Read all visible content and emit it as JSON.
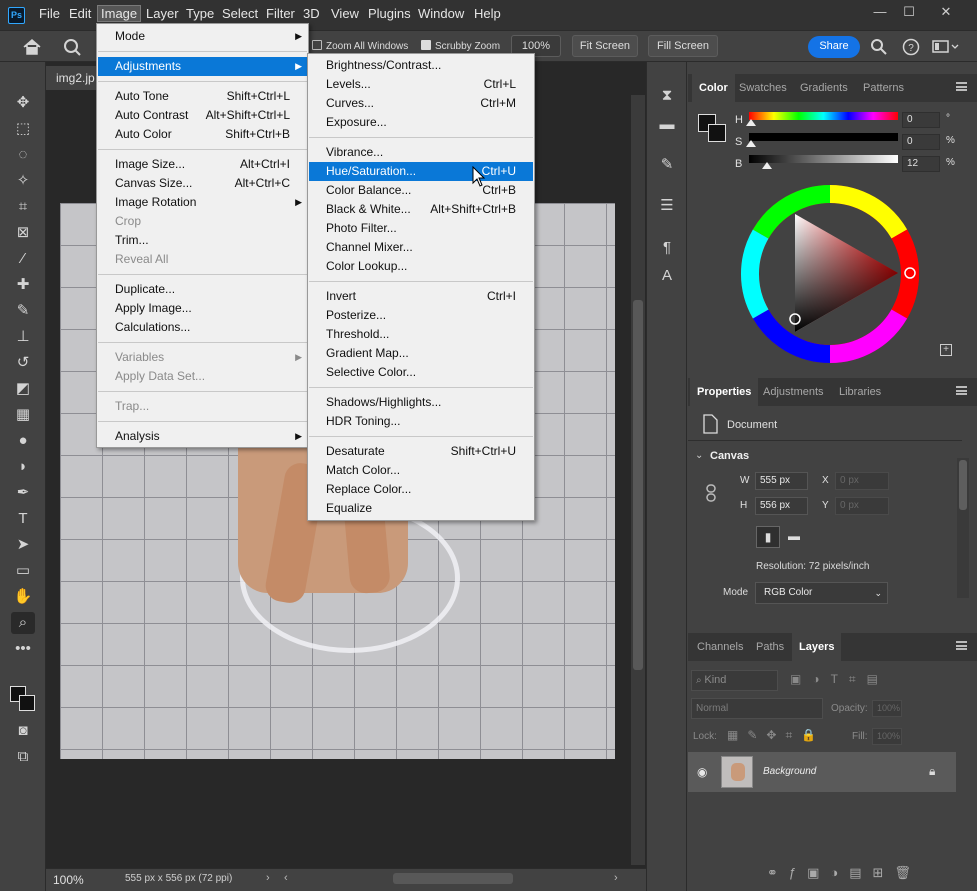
{
  "menubar": {
    "logo": "Ps",
    "items": [
      "File",
      "Edit",
      "Image",
      "Layer",
      "Type",
      "Select",
      "Filter",
      "3D",
      "View",
      "Plugins",
      "Window",
      "Help"
    ],
    "active": "Image",
    "window_controls": {
      "minimize": "—",
      "maximize": "☐",
      "close": "✕"
    }
  },
  "options_bar": {
    "zoom_all_windows": "Zoom All Windows",
    "scrubby_zoom": "Scrubby Zoom",
    "zoom_value": "100%",
    "fit_screen": "Fit Screen",
    "fill_screen": "Fill Screen",
    "share": "Share"
  },
  "document": {
    "tab_name": "img2.jp",
    "zoom": "100%",
    "status": "555 px x 556 px (72 ppi)"
  },
  "image_menu": {
    "groups": [
      [
        {
          "label": "Mode",
          "submenu": true
        }
      ],
      [
        {
          "label": "Adjustments",
          "submenu": true,
          "highlight": true
        }
      ],
      [
        {
          "label": "Auto Tone",
          "shortcut": "Shift+Ctrl+L"
        },
        {
          "label": "Auto Contrast",
          "shortcut": "Alt+Shift+Ctrl+L"
        },
        {
          "label": "Auto Color",
          "shortcut": "Shift+Ctrl+B"
        }
      ],
      [
        {
          "label": "Image Size...",
          "shortcut": "Alt+Ctrl+I"
        },
        {
          "label": "Canvas Size...",
          "shortcut": "Alt+Ctrl+C"
        },
        {
          "label": "Image Rotation",
          "submenu": true
        },
        {
          "label": "Crop",
          "disabled": true
        },
        {
          "label": "Trim..."
        },
        {
          "label": "Reveal All",
          "disabled": true
        }
      ],
      [
        {
          "label": "Duplicate..."
        },
        {
          "label": "Apply Image..."
        },
        {
          "label": "Calculations..."
        }
      ],
      [
        {
          "label": "Variables",
          "submenu": true,
          "disabled": true
        },
        {
          "label": "Apply Data Set...",
          "disabled": true
        }
      ],
      [
        {
          "label": "Trap...",
          "disabled": true
        }
      ],
      [
        {
          "label": "Analysis",
          "submenu": true
        }
      ]
    ]
  },
  "adjustments_menu": {
    "groups": [
      [
        {
          "label": "Brightness/Contrast..."
        },
        {
          "label": "Levels...",
          "shortcut": "Ctrl+L"
        },
        {
          "label": "Curves...",
          "shortcut": "Ctrl+M"
        },
        {
          "label": "Exposure..."
        }
      ],
      [
        {
          "label": "Vibrance..."
        },
        {
          "label": "Hue/Saturation...",
          "shortcut": "Ctrl+U",
          "highlight": true
        },
        {
          "label": "Color Balance...",
          "shortcut": "Ctrl+B"
        },
        {
          "label": "Black & White...",
          "shortcut": "Alt+Shift+Ctrl+B"
        },
        {
          "label": "Photo Filter..."
        },
        {
          "label": "Channel Mixer..."
        },
        {
          "label": "Color Lookup..."
        }
      ],
      [
        {
          "label": "Invert",
          "shortcut": "Ctrl+I"
        },
        {
          "label": "Posterize..."
        },
        {
          "label": "Threshold..."
        },
        {
          "label": "Gradient Map..."
        },
        {
          "label": "Selective Color..."
        }
      ],
      [
        {
          "label": "Shadows/Highlights..."
        },
        {
          "label": "HDR Toning..."
        }
      ],
      [
        {
          "label": "Desaturate",
          "shortcut": "Shift+Ctrl+U"
        },
        {
          "label": "Match Color..."
        },
        {
          "label": "Replace Color..."
        },
        {
          "label": "Equalize"
        }
      ]
    ]
  },
  "color_panel": {
    "tabs": [
      "Color",
      "Swatches",
      "Gradients",
      "Patterns"
    ],
    "active_tab": "Color",
    "sliders": [
      {
        "label": "H",
        "value": "0",
        "unit": "°"
      },
      {
        "label": "S",
        "value": "0",
        "unit": "%"
      },
      {
        "label": "B",
        "value": "12",
        "unit": "%"
      }
    ]
  },
  "properties_panel": {
    "tabs": [
      "Properties",
      "Adjustments",
      "Libraries"
    ],
    "active_tab": "Properties",
    "doc_label": "Document",
    "canvas_section": "Canvas",
    "w_label": "W",
    "w_value": "555 px",
    "h_label": "H",
    "h_value": "556 px",
    "x_label": "X",
    "x_placeholder": "0 px",
    "y_label": "Y",
    "y_placeholder": "0 px",
    "resolution": "Resolution: 72 pixels/inch",
    "mode_label": "Mode",
    "mode_value": "RGB Color"
  },
  "layers_panel": {
    "tabs": [
      "Channels",
      "Paths",
      "Layers"
    ],
    "active_tab": "Layers",
    "kind_placeholder": "Kind",
    "blend_mode": "Normal",
    "opacity_label": "Opacity:",
    "opacity_value": "100%",
    "lock_label": "Lock:",
    "fill_label": "Fill:",
    "fill_value": "100%",
    "layer_name": "Background"
  },
  "colors": {
    "accent": "#1473e6",
    "menu_highlight": "#0a78d7",
    "panel_bg": "#424242",
    "app_bg": "#323232"
  }
}
